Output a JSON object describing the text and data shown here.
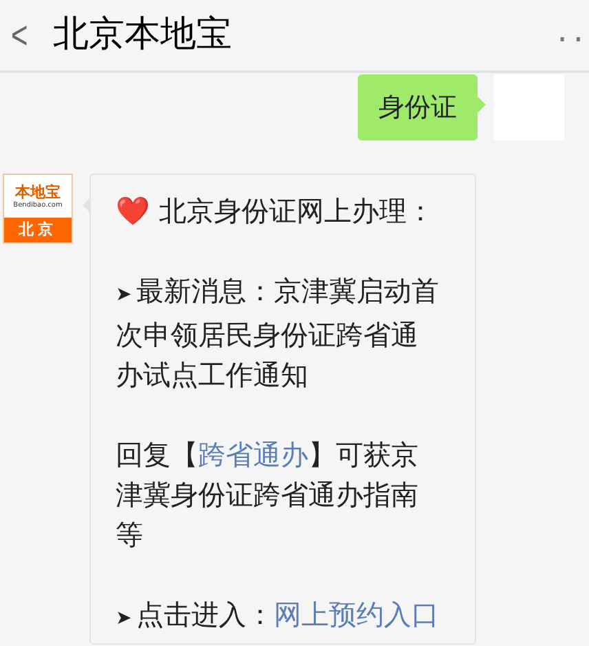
{
  "header": {
    "back": "<",
    "title": "北京本地宝",
    "more": ".."
  },
  "messages": [
    {
      "kind": "outgoing",
      "text": "身份证"
    },
    {
      "kind": "incoming",
      "avatar": {
        "brand": "本地宝",
        "site": "Bendibao.com",
        "city": "北京"
      },
      "paragraphs": [
        [
          {
            "kind": "text",
            "text": "❤️ 北京身份证网上办理："
          }
        ],
        [
          {
            "kind": "bullet",
            "text": "➤"
          },
          {
            "kind": "text",
            "text": "最新消息：京津冀启动首次申领居民身份证跨省通办试点工作通知"
          }
        ],
        [
          {
            "kind": "text",
            "text": "回复【"
          },
          {
            "kind": "link",
            "text": "跨省通办"
          },
          {
            "kind": "text",
            "text": "】可获京津冀身份证跨省通办指南等"
          }
        ],
        [
          {
            "kind": "bullet",
            "text": "➤"
          },
          {
            "kind": "text",
            "text": "点击进入："
          },
          {
            "kind": "link",
            "text": "网上预约入口"
          }
        ]
      ]
    }
  ]
}
